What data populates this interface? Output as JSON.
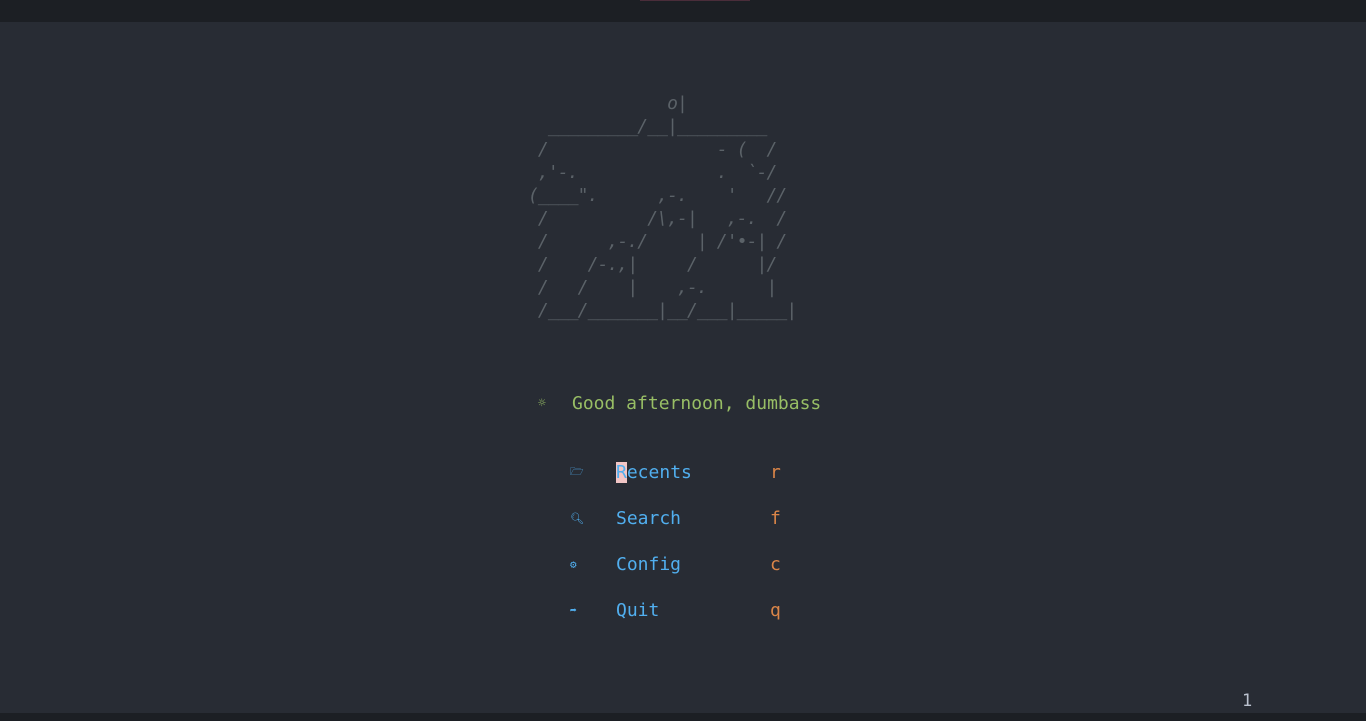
{
  "header": {
    "title": ""
  },
  "banner": {
    "art": "              o|\n  _________/__|_________\n /                 - (  /\n ,'-.              .  `-/\n(____\".      ,-.    '   //\n /          /\\,-|   ,-.  /\n /      ,-./     | /'•-| /\n /    /-.,|     /      |/\n /   /    |    ,-.      |\n /___/_______|__/___|_____|"
  },
  "greeting": {
    "icon": "sun-icon",
    "text": "Good afternoon, dumbass"
  },
  "menu": {
    "items": [
      {
        "icon": "folder-open-icon",
        "glyph": "🗁",
        "label": "Recents",
        "key": "r"
      },
      {
        "icon": "search-icon",
        "glyph": "🔍",
        "label": "Search",
        "key": "f"
      },
      {
        "icon": "gear-icon",
        "glyph": "⚙",
        "label": "Config",
        "key": "c"
      },
      {
        "icon": "quit-icon",
        "glyph": "➦",
        "label": "Quit",
        "key": "q"
      }
    ]
  },
  "statusline": {
    "line_number": "1"
  },
  "colors": {
    "background": "#282c34",
    "bar": "#1c1f24",
    "ascii": "#5b6268",
    "greeting": "#98be65",
    "menu": "#51afef",
    "key": "#da8548"
  }
}
